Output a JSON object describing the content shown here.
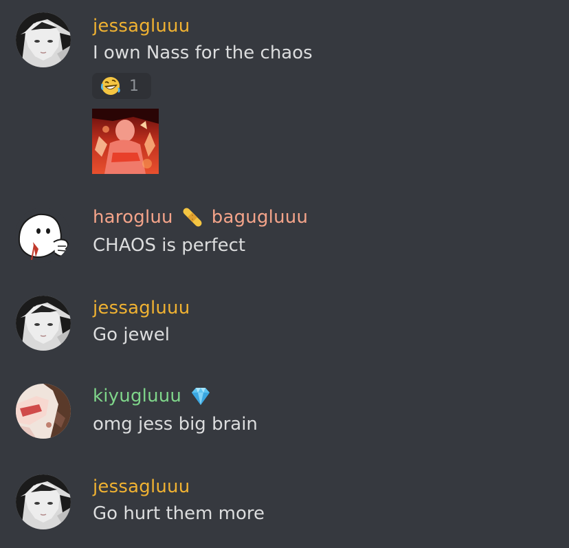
{
  "colors": {
    "background": "#36393f",
    "jessagluuu": "#f0b232",
    "harogluu": "#f4a48a",
    "bagugluuu": "#f4a48a",
    "kiyugluuu": "#7fd58a",
    "text": "#dcddde",
    "muted": "#8e9297"
  },
  "messages": [
    {
      "author": "jessagluuu",
      "text": "I own Nass for the chaos",
      "reaction": {
        "emoji": "rofl-emoji",
        "count": "1"
      },
      "attachment": "gif-thumbnail"
    },
    {
      "author": "harogluu",
      "connector_icon": "bandage-icon",
      "second_author": "bagugluuu",
      "text": "CHAOS is perfect"
    },
    {
      "author": "jessagluuu",
      "text": "Go jewel"
    },
    {
      "author": "kiyugluuu",
      "badge_icon": "diamond-icon",
      "text": "omg jess big brain"
    },
    {
      "author": "jessagluuu",
      "text": "Go hurt them more"
    }
  ]
}
